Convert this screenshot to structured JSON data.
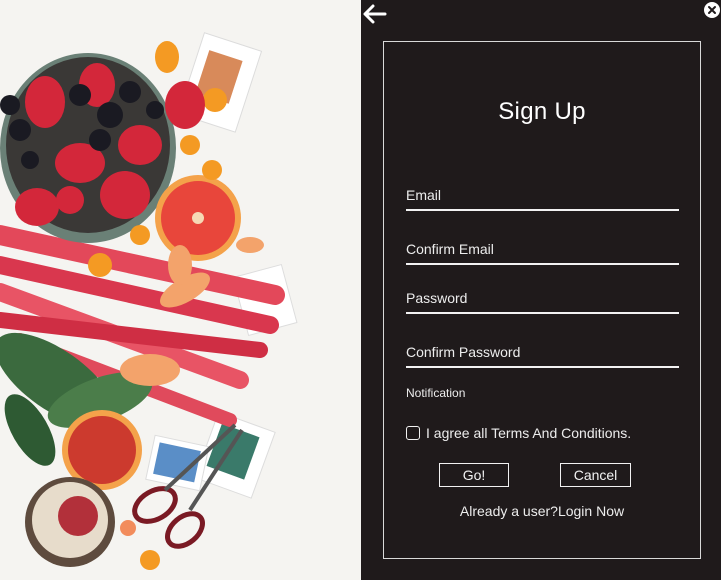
{
  "form": {
    "title": "Sign Up",
    "fields": [
      {
        "placeholder": "Email",
        "value": ""
      },
      {
        "placeholder": "Confirm Email",
        "value": ""
      },
      {
        "placeholder": "Password",
        "value": ""
      },
      {
        "placeholder": "Confirm Password",
        "value": ""
      }
    ],
    "notification_label": "Notification",
    "terms_label": "I agree all Terms And Conditions.",
    "terms_checked": false,
    "go_label": "Go!",
    "cancel_label": "Cancel",
    "login_prompt": "Already a user?",
    "login_link": "Login Now"
  },
  "icons": {
    "back": "arrow-left-icon",
    "close": "close-icon"
  },
  "colors": {
    "panel_background": "#1f1a1b",
    "text": "#ffffff",
    "border": "#d9d9d9"
  }
}
